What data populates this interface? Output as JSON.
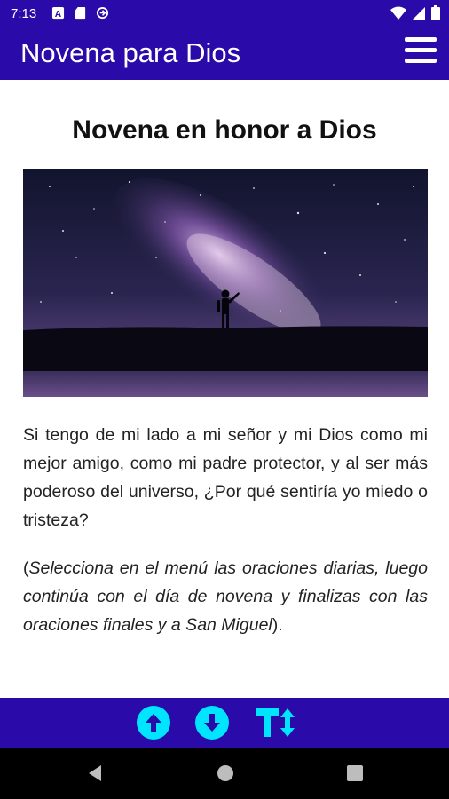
{
  "status_bar": {
    "time": "7:13",
    "left_icons": [
      "font-notification-icon",
      "sd-card-icon",
      "sync-icon"
    ],
    "right_icons": [
      "wifi-icon",
      "signal-icon",
      "battery-icon"
    ]
  },
  "app_bar": {
    "title": "Novena para Dios",
    "menu_icon": "hamburger-menu-icon"
  },
  "content": {
    "heading": "Novena en honor a Dios",
    "image": "milky-way-silhouette-image",
    "paragraph": "Si tengo de mi lado a mi señor y mi Dios como mi mejor amigo, como mi padre protector, y al ser más poderoso del universo, ¿Por qué sentiría yo miedo o tristeza?",
    "instruction": {
      "open_paren": "(",
      "text": "Selecciona en el menú las oraciones diarias, luego continúa con el día de novena y finalizas con las oraciones finales y a San Miguel",
      "close_paren": ")."
    }
  },
  "bottom_bar": {
    "buttons": [
      "scroll-up-icon",
      "scroll-down-icon",
      "text-size-icon"
    ],
    "accent_color": "#00e5ff",
    "background_color": "#2a0aa8"
  },
  "nav_bar": {
    "buttons": [
      "back-icon",
      "home-icon",
      "recents-icon"
    ]
  }
}
